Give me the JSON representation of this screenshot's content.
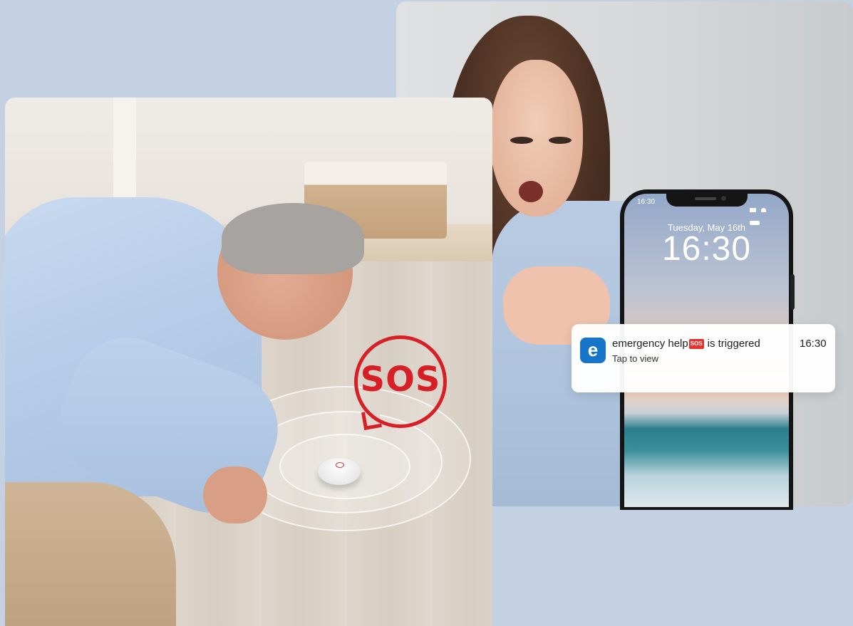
{
  "callout": {
    "sos_text": "SOS"
  },
  "phone": {
    "status_time": "16:30",
    "lock_date": "Tuesday, May 16th",
    "lock_time": "16:30"
  },
  "notification": {
    "app_icon_letter": "e",
    "title_before": "emergency help",
    "badge": "SOS",
    "title_after": "is triggered",
    "subtitle": "Tap to view",
    "time": "16:30"
  },
  "colors": {
    "background": "#c4d1e2",
    "sos_red": "#d71f26",
    "app_blue": "#1675c8"
  },
  "icons": [
    "sos-speech-bubble-icon",
    "sos-button-device-icon",
    "app-icon",
    "signal-icon",
    "wifi-icon",
    "battery-icon"
  ]
}
